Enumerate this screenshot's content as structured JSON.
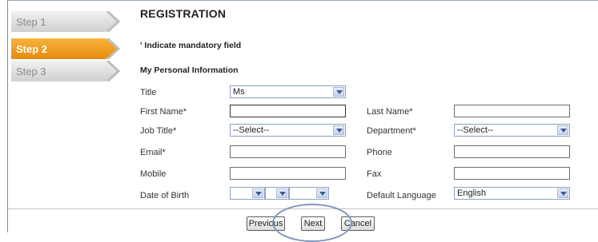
{
  "steps": [
    {
      "label": "Step 1",
      "active": false
    },
    {
      "label": "Step 2",
      "active": true
    },
    {
      "label": "Step 3",
      "active": false
    }
  ],
  "page_title": "REGISTRATION",
  "mandatory_note": "' Indicate mandatory field",
  "section_title": "My Personal Information",
  "form": {
    "title_label": "Title",
    "title_value": "Ms",
    "first_name_label": "First Name*",
    "first_name_value": "",
    "last_name_label": "Last Name*",
    "last_name_value": "",
    "job_title_label": "Job Title*",
    "job_title_value": "--Select--",
    "department_label": "Department*",
    "department_value": "--Select--",
    "email_label": "Email*",
    "email_value": "",
    "phone_label": "Phone",
    "phone_value": "",
    "mobile_label": "Mobile",
    "mobile_value": "",
    "fax_label": "Fax",
    "fax_value": "",
    "dob_label": "Date of Birth",
    "dob_day": "",
    "dob_month": "",
    "dob_year": "",
    "language_label": "Default Language",
    "language_value": "English"
  },
  "buttons": {
    "previous": "Previous",
    "next": "Next",
    "cancel": "Cancel"
  },
  "colors": {
    "active_step": "#f29a1c",
    "inactive_step": "#d9d9d9",
    "select_border": "#8da0bd",
    "annotation": "#8096ba"
  }
}
